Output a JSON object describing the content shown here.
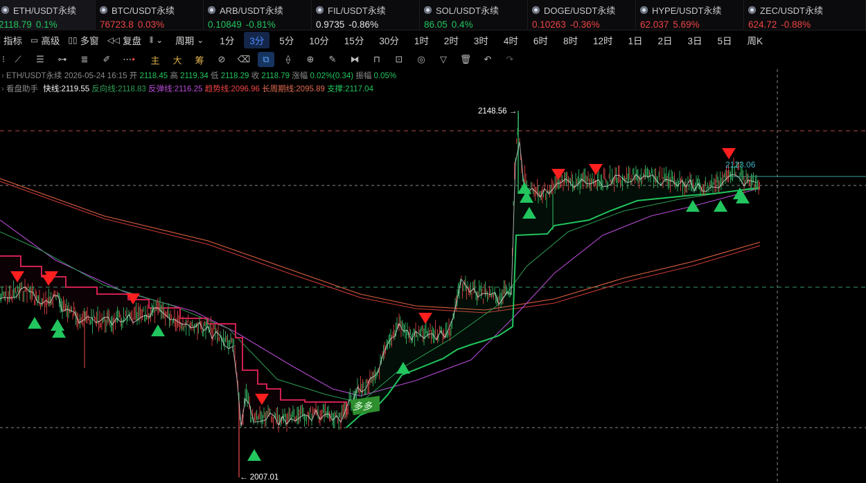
{
  "tickers": [
    {
      "name": "ETH/USDT永续",
      "price": "2118.79",
      "change": "0.1%",
      "dir": "up",
      "active": true,
      "width": 138
    },
    {
      "name": "BTC/USDT永续",
      "price": "76723.8",
      "change": "0.03%",
      "dir": "down",
      "width": 156
    },
    {
      "name": "ARB/USDT永续",
      "price": "0.10849",
      "change": "-0.81%",
      "dir": "up",
      "width": 156
    },
    {
      "name": "FIL/USDT永续",
      "price": "0.9735",
      "change": "-0.86%",
      "dir": "neutral",
      "width": 156
    },
    {
      "name": "SOL/USDT永续",
      "price": "86.05",
      "change": "0.4%",
      "dir": "up",
      "width": 156
    },
    {
      "name": "DOGE/USDT永续",
      "price": "0.10263",
      "change": "-0.36%",
      "dir": "down",
      "width": 156
    },
    {
      "name": "HYPE/USDT永续",
      "price": "62.037",
      "change": "5.69%",
      "dir": "down",
      "width": 156
    },
    {
      "name": "ZEC/USDT永续",
      "price": "624.72",
      "change": "-0.88%",
      "dir": "down",
      "width": 176
    }
  ],
  "toolbar": {
    "indicators": "指标",
    "advanced": "高级",
    "multi_window": "多窗",
    "replay": "复盘",
    "period_label": "周期",
    "periods": [
      "1分",
      "3分",
      "5分",
      "10分",
      "15分",
      "30分",
      "1时",
      "2时",
      "3时",
      "4时",
      "6时",
      "8时",
      "12时",
      "1日",
      "2日",
      "3日",
      "5日",
      "周K"
    ],
    "active_period": "3分"
  },
  "drawbar": {
    "main": "主",
    "big": "大",
    "chips": "筹"
  },
  "info": {
    "line1": {
      "symbol": "ETH/USDT永续",
      "datetime": "2026-05-24 16:15",
      "open_label": "开",
      "open": "2118.45",
      "high_label": "高",
      "high": "2119.34",
      "low_label": "低",
      "low": "2118.29",
      "close_label": "收",
      "close": "2118.79",
      "chg_label": "涨幅",
      "chg": "0.02%(0.34)",
      "amp_label": "振幅",
      "amp": "0.05%"
    },
    "line2": {
      "name": "看盘助手",
      "fast": "快线:2119.55",
      "reverse": "反向线:2118.83",
      "rebound": "反弹线:2116.25",
      "trend": "趋势线:2096.96",
      "long": "长周期线:2095.89",
      "support": "支撑:2117.04"
    }
  },
  "chart_labels": {
    "high_marker": "2148.56 →",
    "low_marker": "← 2007.01",
    "last_price": "2123.06",
    "badge": "多多"
  },
  "colors": {
    "up": "#22c55e",
    "down": "#ef4444",
    "active_period": "#4c8dff",
    "reverse_line": "#2e9e57",
    "rebound_line": "#b64bd4",
    "trend_line": "#ef4444",
    "long_line": "#e06a50",
    "support_line": "#22c55e"
  }
}
